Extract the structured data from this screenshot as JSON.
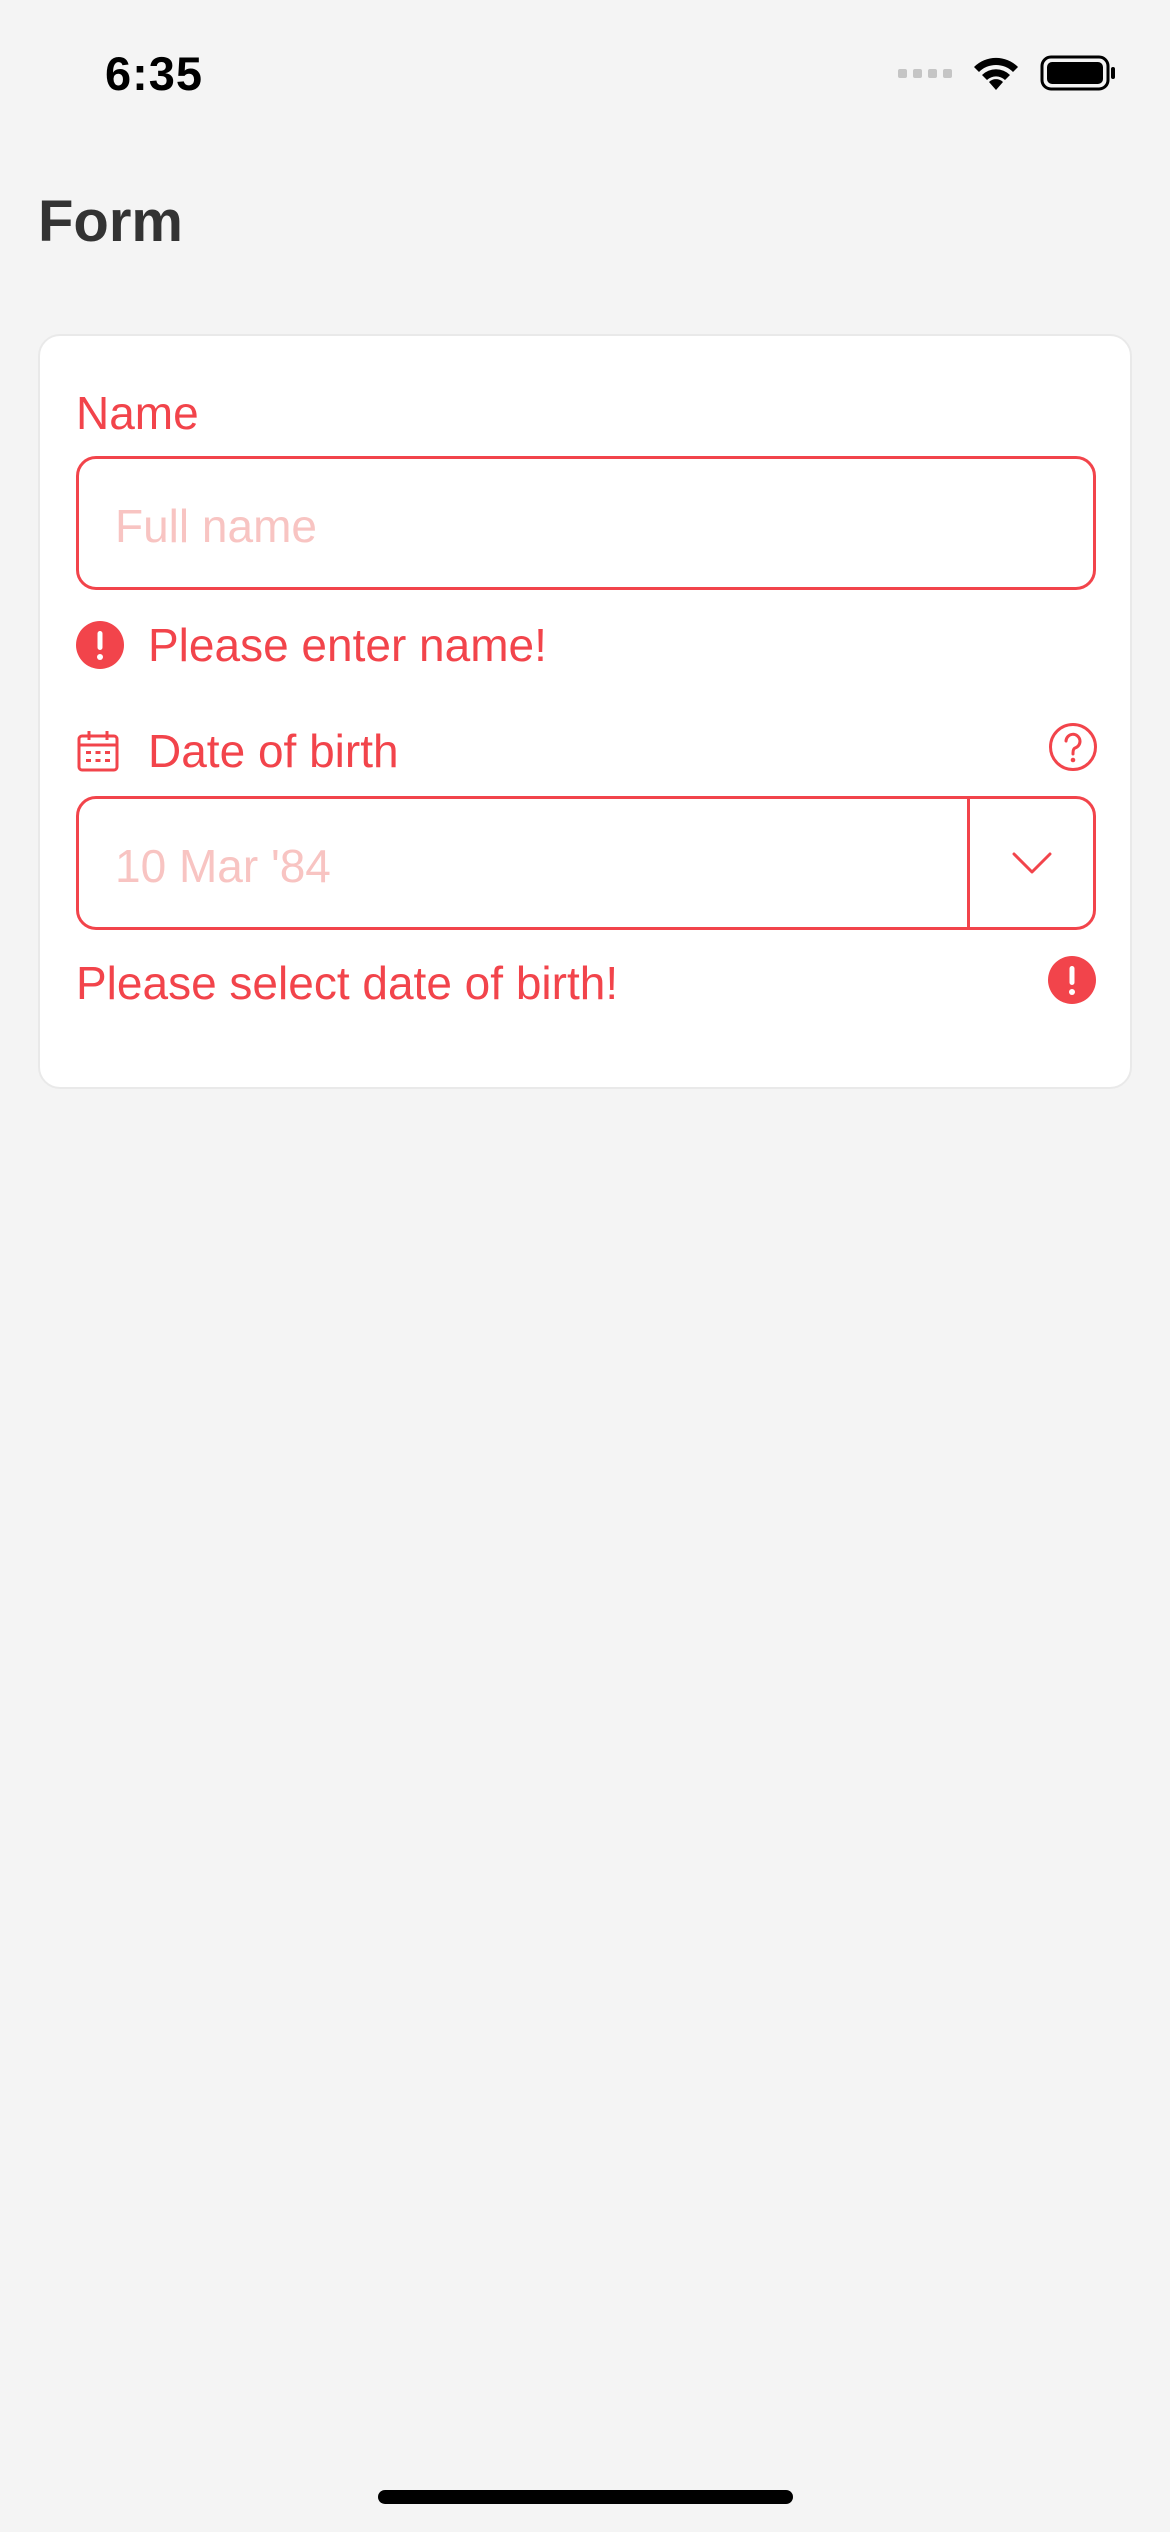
{
  "status_bar": {
    "time": "6:35"
  },
  "header": {
    "title": "Form"
  },
  "form": {
    "name_field": {
      "label": "Name",
      "placeholder": "Full name",
      "error": "Please enter name!"
    },
    "dob_field": {
      "label": "Date of birth",
      "placeholder": "10 Mar '84",
      "error": "Please select date of birth!"
    }
  },
  "colors": {
    "error": "#f2444b",
    "placeholder": "#f8c4c2",
    "background": "#f4f4f4",
    "title": "#333333"
  },
  "icons": {
    "calendar": "calendar-icon",
    "help": "question-circle-icon",
    "error": "exclamation-circle-icon",
    "dropdown": "chevron-down-icon"
  }
}
